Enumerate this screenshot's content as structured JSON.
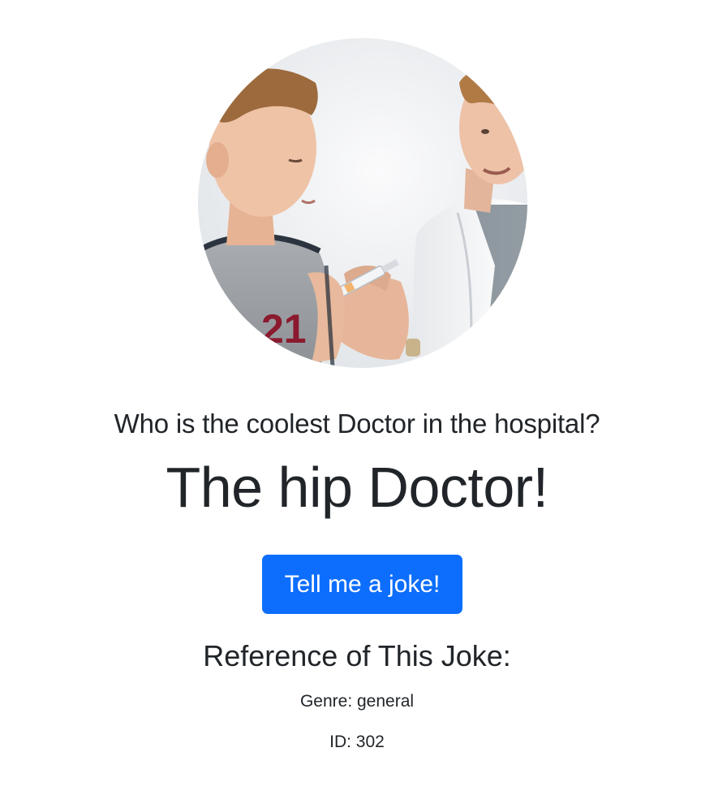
{
  "joke": {
    "setup": "Who is the coolest Doctor in the hospital?",
    "punchline": "The hip Doctor!"
  },
  "actions": {
    "new_joke_label": "Tell me a joke!"
  },
  "reference": {
    "title": "Reference of This Joke:",
    "genre": "Genre: general",
    "id": "ID: 302"
  },
  "theme": {
    "button_color": "#0d6efd",
    "text_color": "#212529"
  }
}
